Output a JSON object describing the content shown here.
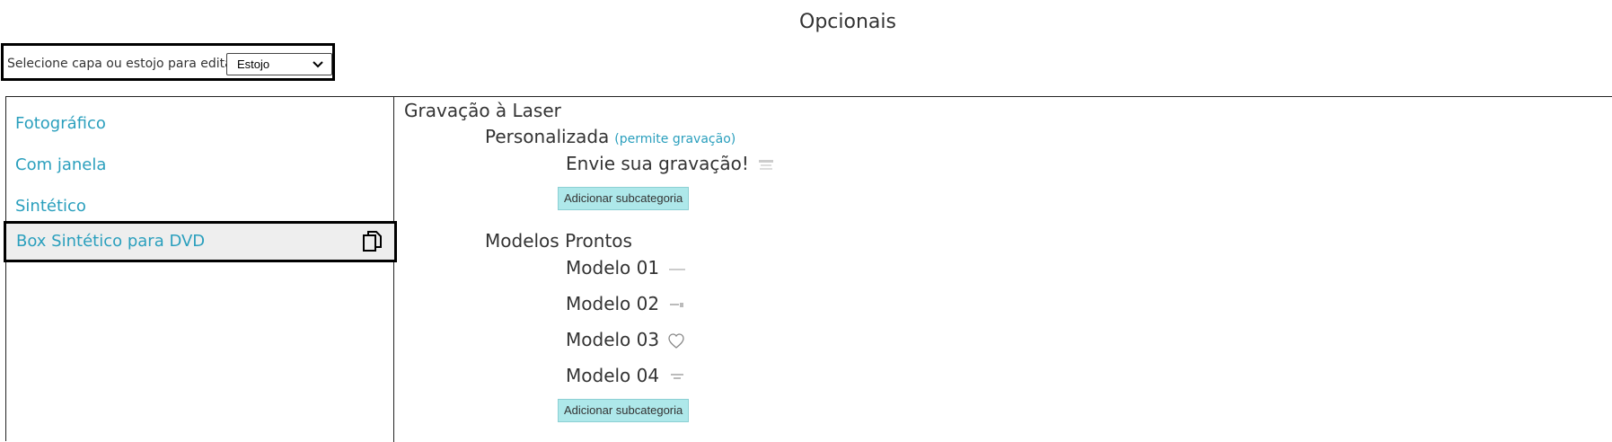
{
  "page": {
    "title": "Opcionais"
  },
  "selector": {
    "label": "Selecione capa ou estojo para editar:",
    "value": "Estojo"
  },
  "sidebar": {
    "items": [
      {
        "label": "Fotográfico"
      },
      {
        "label": "Com janela"
      },
      {
        "label": "Sintético"
      },
      {
        "label": "Box Sintético para DVD",
        "active": true
      }
    ]
  },
  "content": {
    "section_title": "Gravação à Laser",
    "groups": [
      {
        "title": "Personalizada",
        "note": "(permite gravação)",
        "items": [
          "Envie sua gravação!"
        ],
        "add_button": "Adicionar subcategoria"
      },
      {
        "title": "Modelos Prontos",
        "items": [
          "Modelo 01",
          "Modelo 02",
          "Modelo 03",
          "Modelo 04"
        ],
        "add_button": "Adicionar subcategoria"
      }
    ]
  },
  "colors": {
    "accent": "#2a9fbd",
    "button_bg": "#aee8ea",
    "active_bg": "#eeeeee"
  }
}
